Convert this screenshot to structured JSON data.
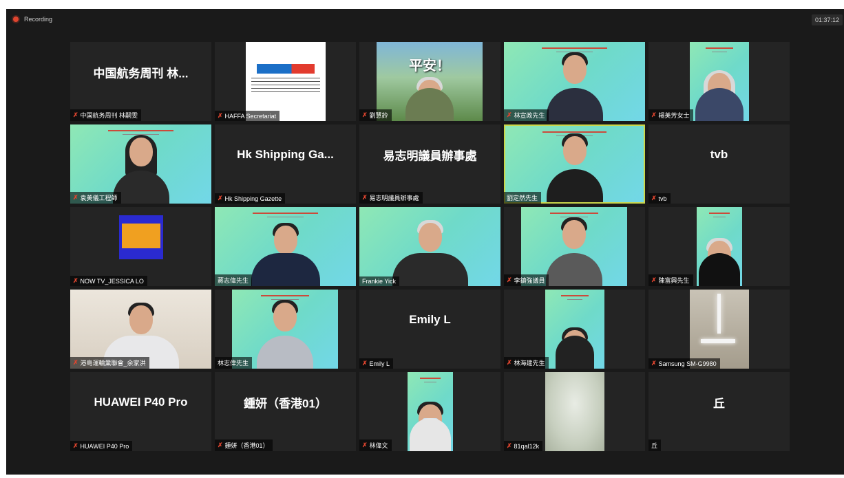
{
  "recording": {
    "label": "Recording"
  },
  "timer": {
    "value": "01:37:12"
  },
  "colors": {
    "background": "#1a1a1a",
    "tile": "#242424",
    "active_border": "#cad64a",
    "mic_muted": "#e0452f"
  },
  "participants": [
    {
      "name": "中国航务周刊 林...",
      "label": "中国航务周刊 林嗣雯",
      "muted": true
    },
    {
      "name": "",
      "label": "HAFFA Secretariat",
      "muted": true,
      "logo": "HAFFA"
    },
    {
      "name": "平安！",
      "label": "劉慧鈴",
      "muted": true
    },
    {
      "name": "",
      "label": "林宣政先生",
      "muted": true
    },
    {
      "name": "",
      "label": "楊美芳女士",
      "muted": true
    },
    {
      "name": "",
      "label": "袁美儀工程師",
      "muted": true
    },
    {
      "name": "Hk Shipping Ga...",
      "label": "Hk Shipping Gazette",
      "muted": true
    },
    {
      "name": "易志明議員辦事處",
      "label": "易志明議員辦事處",
      "muted": true
    },
    {
      "name": "",
      "label": "劉定然先生",
      "muted": false,
      "active_speaker": true
    },
    {
      "name": "tvb",
      "label": "tvb",
      "muted": true
    },
    {
      "name": "",
      "label": "NOW TV_JESSICA LO",
      "muted": true,
      "logo": "now"
    },
    {
      "name": "",
      "label": "蔣志偉先生",
      "muted": false
    },
    {
      "name": "",
      "label": "Frankie Yick",
      "muted": false
    },
    {
      "name": "",
      "label": "李鎮強議員",
      "muted": true
    },
    {
      "name": "",
      "label": "陳富興先生",
      "muted": true
    },
    {
      "name": "",
      "label": "港島運輸業聯會_余家洪",
      "muted": true
    },
    {
      "name": "",
      "label": "林志偉先生",
      "muted": false
    },
    {
      "name": "Emily L",
      "label": "Emily L",
      "muted": true
    },
    {
      "name": "",
      "label": "林海建先生",
      "muted": true
    },
    {
      "name": "",
      "label": "Samsung SM-G9980",
      "muted": true
    },
    {
      "name": "HUAWEI P40 Pro",
      "label": "HUAWEI P40 Pro",
      "muted": true
    },
    {
      "name": "鍾妍（香港01）",
      "label": "鍾妍（香港01）",
      "muted": true
    },
    {
      "name": "",
      "label": "林偉文",
      "muted": true
    },
    {
      "name": "",
      "label": "81qal12k",
      "muted": true
    },
    {
      "name": "丘",
      "label": "丘",
      "muted": false
    }
  ]
}
